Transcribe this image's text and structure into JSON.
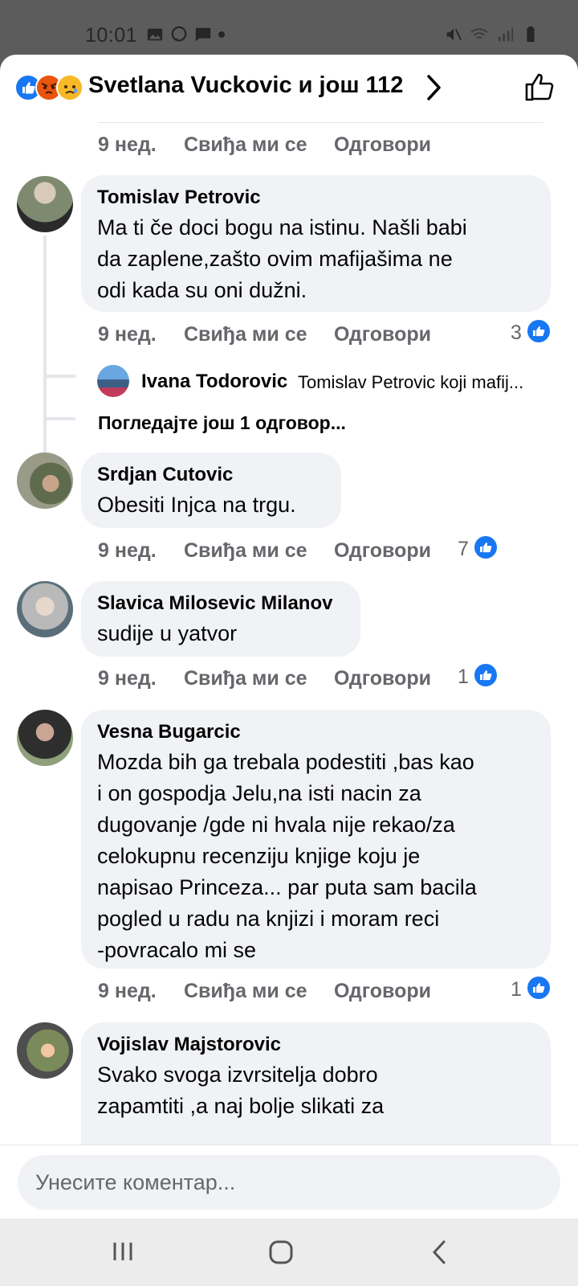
{
  "status_bar": {
    "time": "10:01"
  },
  "header": {
    "title": "Svetlana Vuckovic и још 112"
  },
  "top_meta": {
    "time": "9 нед.",
    "like": "Свиђа ми се",
    "reply": "Одговори"
  },
  "comments": [
    {
      "author": "Tomislav Petrovic",
      "lines": [
        "Ma ti če doci bogu na istinu. Našli babi",
        "da zaplene,zašto ovim mafijašima ne",
        "odi kada su oni dužni."
      ],
      "time": "9 нед.",
      "like": "Свиђа ми се",
      "reply": "Одговори",
      "likes": "3"
    },
    {
      "author": "Srdjan Cutovic",
      "lines": [
        "Obesiti Injca na trgu."
      ],
      "time": "9 нед.",
      "like": "Свиђа ми се",
      "reply": "Одговори",
      "likes": "7"
    },
    {
      "author": "Slavica Milosevic Milanov",
      "lines": [
        "sudije u yatvor"
      ],
      "time": "9 нед.",
      "like": "Свиђа ми се",
      "reply": "Одговори",
      "likes": "1"
    },
    {
      "author": "Vesna Bugarcic",
      "lines": [
        "Mozda bih ga trebala podestiti ,bas kao",
        "i on gospodja Jelu,na isti nacin za",
        "dugovanje /gde ni hvala nije rekao/za",
        "celokupnu recenziju knjige koju je",
        "napisao Princeza... par puta sam bacila",
        "pogled u radu na knjizi i moram reci",
        "-povracalo mi se"
      ],
      "time": "9 нед.",
      "like": "Свиђа ми се",
      "reply": "Одговори",
      "likes": "1"
    },
    {
      "author": "Vojislav Majstorovic",
      "lines": [
        "Svako svoga izvrsitelja dobro",
        "zapamtiti ,a naj bolje slikati za"
      ]
    }
  ],
  "reply_preview": {
    "author": "Ivana Todorovic",
    "text": "Tomislav Petrovic koji mafij..."
  },
  "more_replies": "Погледајте још 1 одговор...",
  "input": {
    "placeholder": "Унесите коментар..."
  },
  "colors": {
    "accent": "#1877f2",
    "bubble": "#f0f2f5",
    "meta": "#65676b"
  }
}
